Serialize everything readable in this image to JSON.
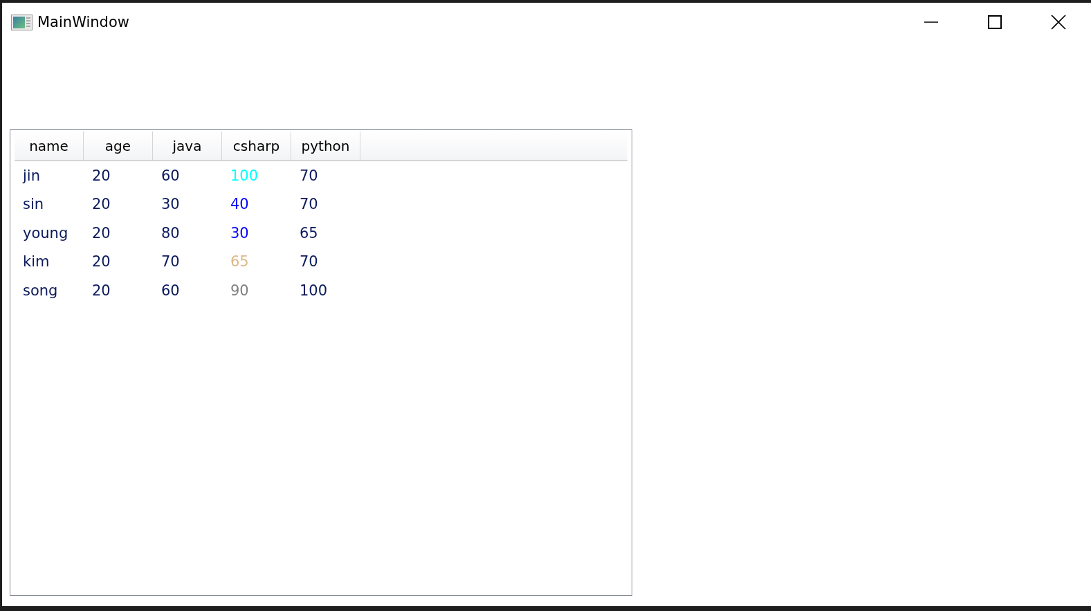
{
  "window": {
    "title": "MainWindow"
  },
  "table": {
    "columns": [
      "name",
      "age",
      "java",
      "csharp",
      "python"
    ],
    "rows": [
      {
        "cells": [
          {
            "text": "jin"
          },
          {
            "text": "20"
          },
          {
            "text": "60"
          },
          {
            "text": "100",
            "color": "#00ffff"
          },
          {
            "text": "70"
          }
        ]
      },
      {
        "cells": [
          {
            "text": "sin"
          },
          {
            "text": "20"
          },
          {
            "text": "30"
          },
          {
            "text": "40",
            "color": "#0000ff"
          },
          {
            "text": "70"
          }
        ]
      },
      {
        "cells": [
          {
            "text": "young"
          },
          {
            "text": "20"
          },
          {
            "text": "80"
          },
          {
            "text": "30",
            "color": "#0000ff"
          },
          {
            "text": "65"
          }
        ]
      },
      {
        "cells": [
          {
            "text": "kim"
          },
          {
            "text": "20"
          },
          {
            "text": "70"
          },
          {
            "text": "65",
            "color": "#deb887"
          },
          {
            "text": "70"
          }
        ]
      },
      {
        "cells": [
          {
            "text": "song"
          },
          {
            "text": "20"
          },
          {
            "text": "60"
          },
          {
            "text": "90",
            "color": "#808080"
          },
          {
            "text": "100"
          }
        ]
      }
    ]
  }
}
